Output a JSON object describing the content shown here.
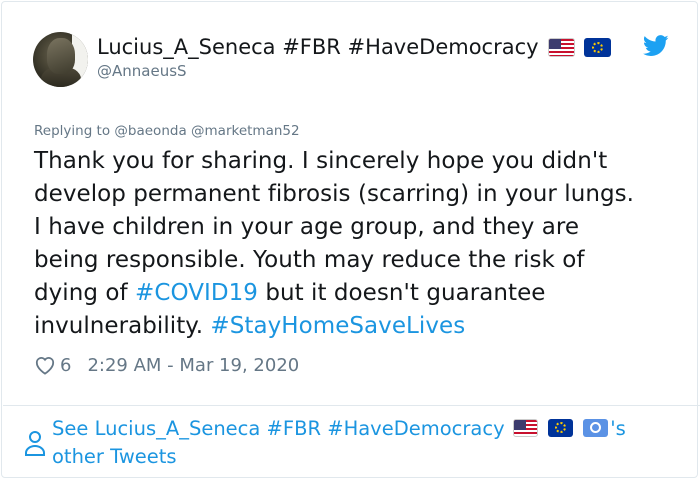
{
  "author": {
    "display_name": "Lucius_A_Seneca #FBR #HaveDemocracy",
    "username": "@AnnaeusS",
    "flags": [
      "us-flag-icon",
      "eu-flag-icon"
    ]
  },
  "reply": {
    "prefix": "Replying to",
    "mentions": [
      "@baeonda",
      "@marketman52"
    ]
  },
  "tweet": {
    "lines": [
      {
        "text": "Thank you for sharing. I sincerely hope you didn't"
      },
      {
        "text": "develop permanent fibrosis (scarring) in your lungs."
      },
      {
        "text": "I have children in your age group, and they are"
      },
      {
        "text": "being responsible. Youth may reduce the risk of"
      },
      {
        "before": "dying of ",
        "hashtag": "#COVID19",
        "after": " but it doesn't guarantee"
      },
      {
        "before": "invulnerability. ",
        "hashtag": "#StayHomeSaveLives",
        "after": ""
      }
    ]
  },
  "meta": {
    "like_count": "6",
    "timestamp": "2:29 AM - Mar 19, 2020"
  },
  "footer": {
    "see_label": "See Lucius_A_Seneca #FBR #HaveDemocracy",
    "suffix": "'s",
    "other": "other Tweets",
    "flags": [
      "us-flag-icon",
      "eu-flag-icon",
      "un-flag-icon"
    ]
  },
  "colors": {
    "link": "#1b95e0",
    "muted": "#657786",
    "text": "#14171a",
    "border": "#e1e8ed"
  }
}
